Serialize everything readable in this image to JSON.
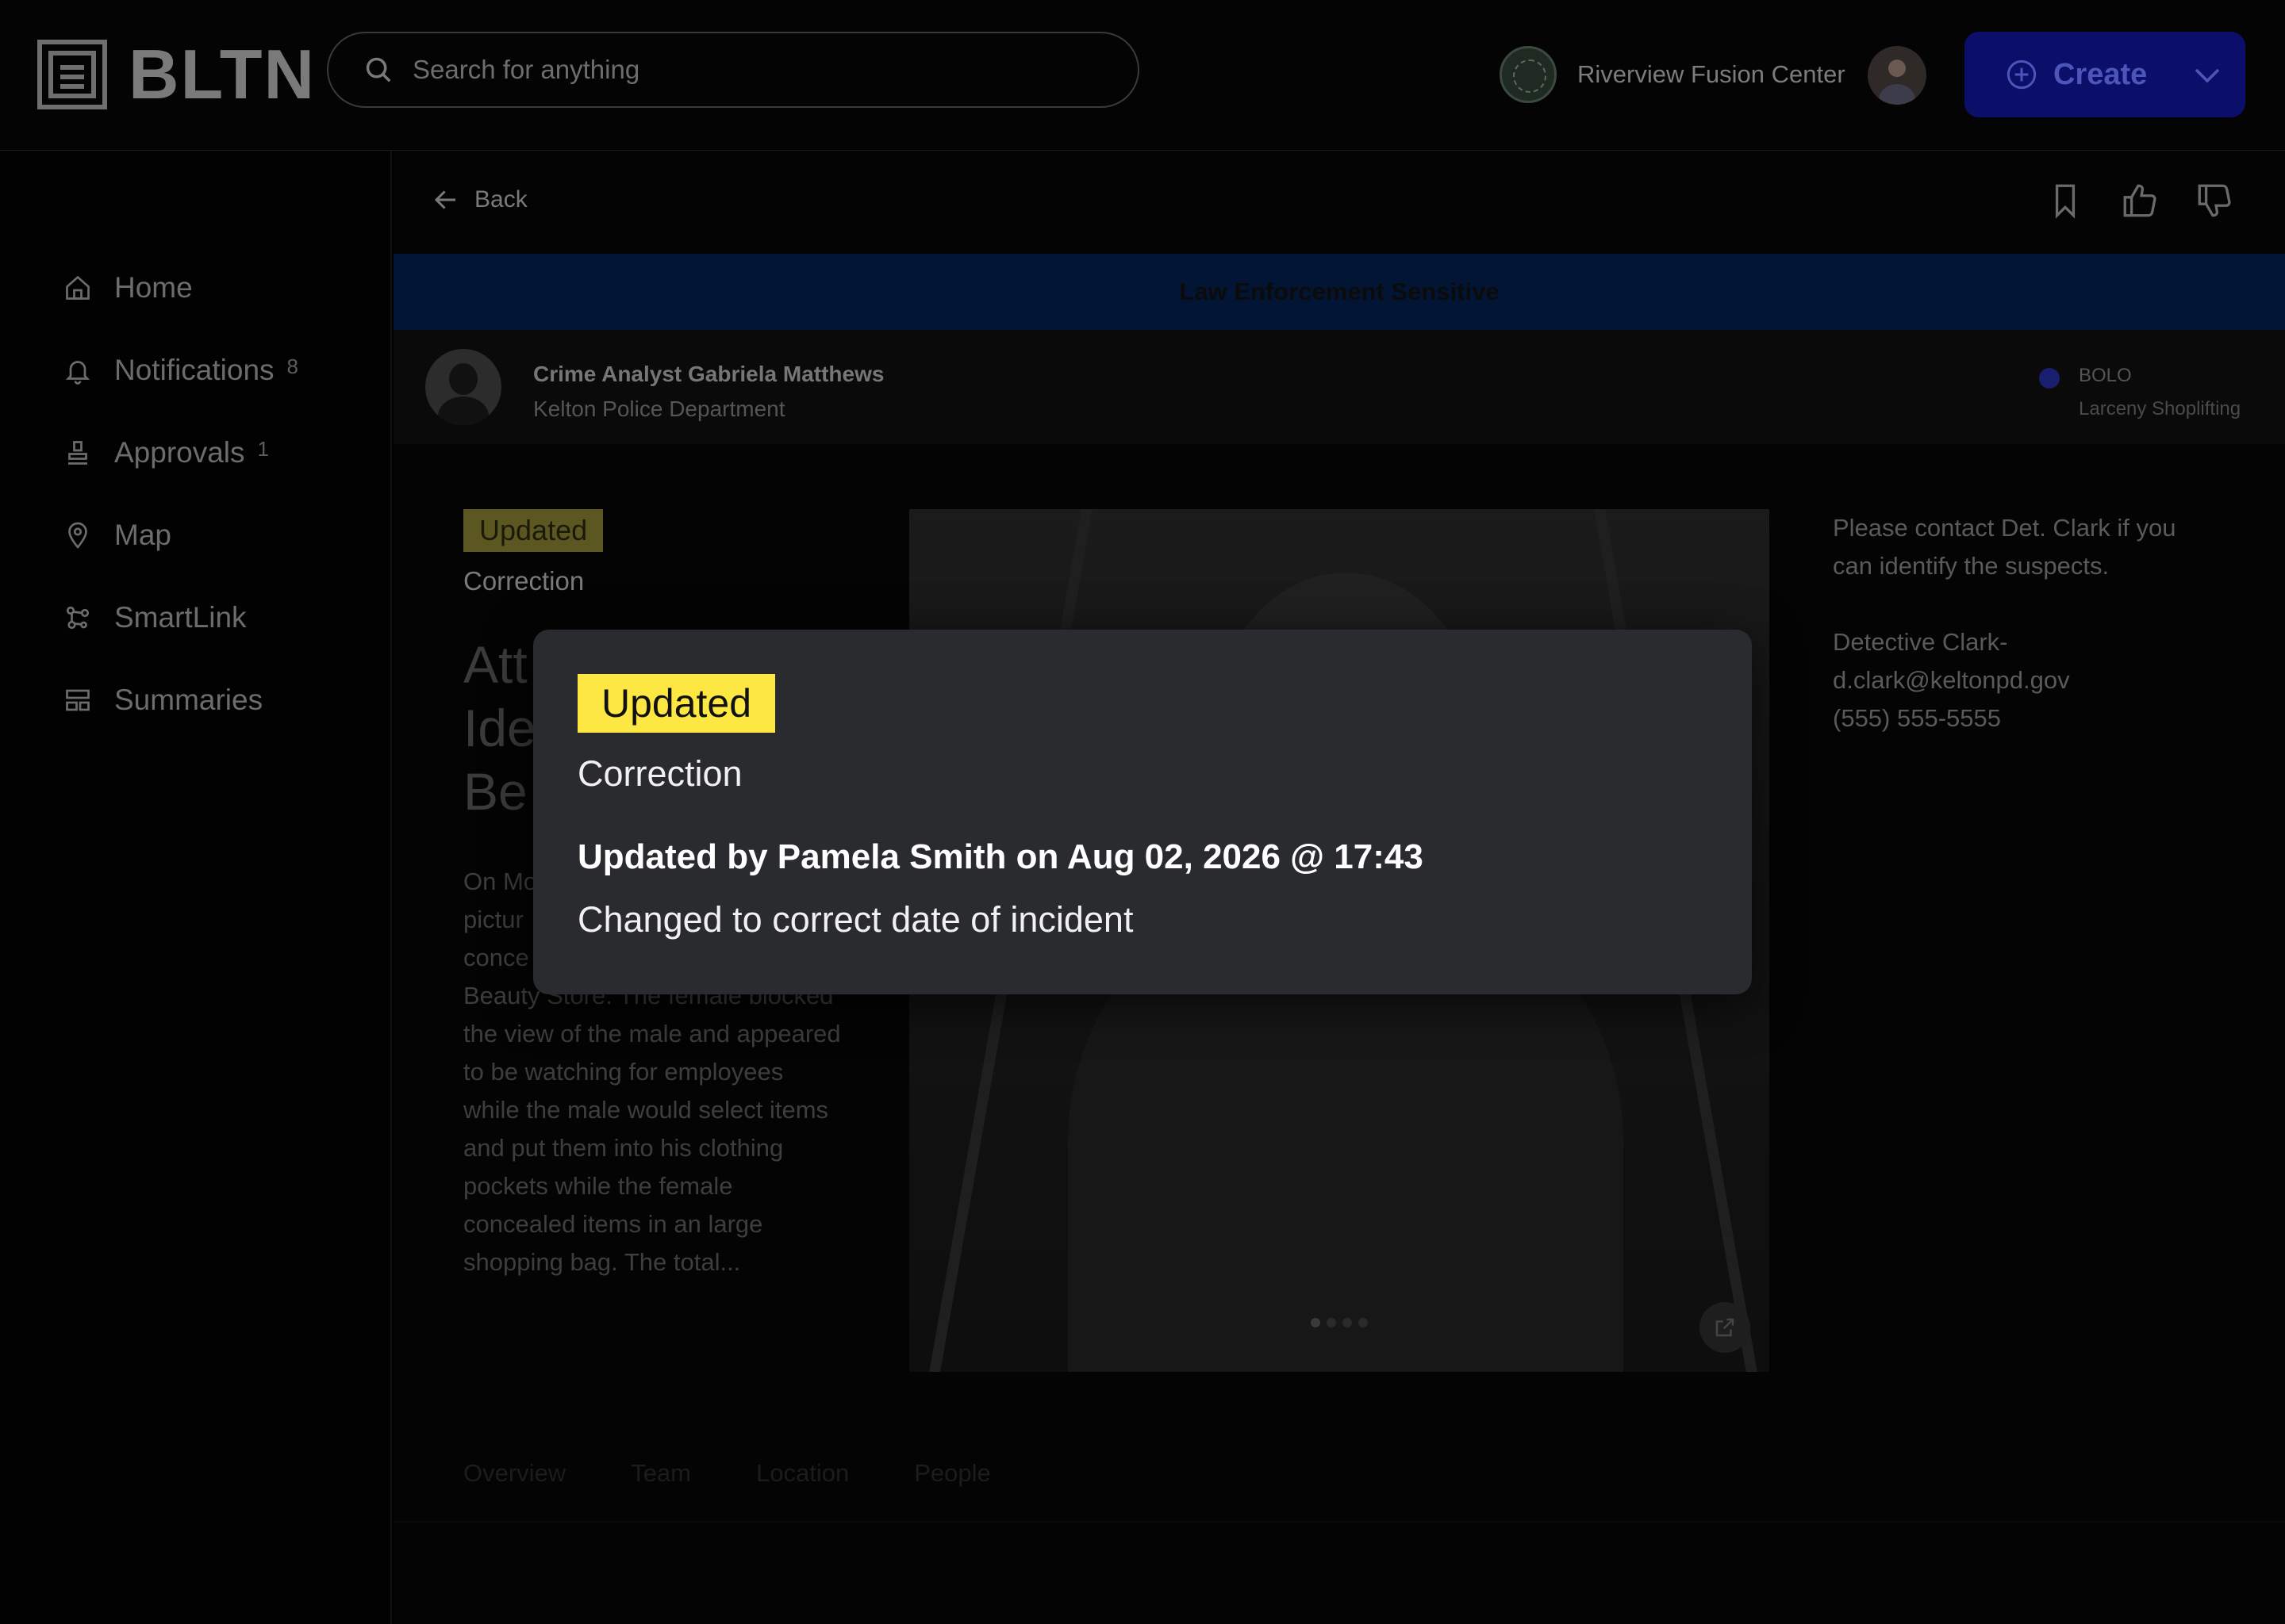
{
  "header": {
    "logo_text": "BLTN",
    "search_placeholder": "Search for anything",
    "org_name": "Riverview Fusion Center",
    "create_label": "Create"
  },
  "sidebar": {
    "items": [
      {
        "label": "Home",
        "icon": "home-icon",
        "count": ""
      },
      {
        "label": "Notifications",
        "icon": "bell-icon",
        "count": "8"
      },
      {
        "label": "Approvals",
        "icon": "stamp-icon",
        "count": "1"
      },
      {
        "label": "Map",
        "icon": "map-pin-icon",
        "count": ""
      },
      {
        "label": "SmartLink",
        "icon": "nodes-icon",
        "count": ""
      },
      {
        "label": "Summaries",
        "icon": "layout-icon",
        "count": ""
      }
    ]
  },
  "content": {
    "back_label": "Back",
    "banner_text": "Law Enforcement Sensitive",
    "author_name": "Crime Analyst Gabriela Matthews",
    "author_dept": "Kelton Police Department",
    "bulletin_type": "BOLO",
    "bulletin_subtype": "Larceny Shoplifting",
    "badge": "Updated",
    "badge_sub": "Correction",
    "title_partial": [
      "Att",
      "Ide",
      "Be"
    ],
    "description_partial": [
      "On Mo",
      "pictur",
      "conce",
      "Beauty Store. The female blocked",
      "the view of the male and appeared",
      "to be watching for employees",
      "while the male would select items",
      "and put them into his clothing",
      "pockets while the female",
      "concealed items in an large",
      "shopping bag. The total..."
    ],
    "contact_note": "Please contact Det. Clark if you can identify the suspects.",
    "contact_name": "Detective Clark-",
    "contact_email": "d.clark@keltonpd.gov",
    "contact_phone": "(555) 555-5555",
    "tabs": [
      "Overview",
      "Team",
      "Location",
      "People"
    ]
  },
  "modal": {
    "badge": "Updated",
    "subtitle": "Correction",
    "updated_by": "Updated by Pamela Smith on Aug 02, 2026 @ 17:43",
    "note": "Changed to correct date of incident"
  },
  "colors": {
    "badge_yellow": "#fde843",
    "create_blue": "#0b0f6a",
    "banner_blue": "#021534",
    "modal_bg": "#2a2b2e"
  }
}
